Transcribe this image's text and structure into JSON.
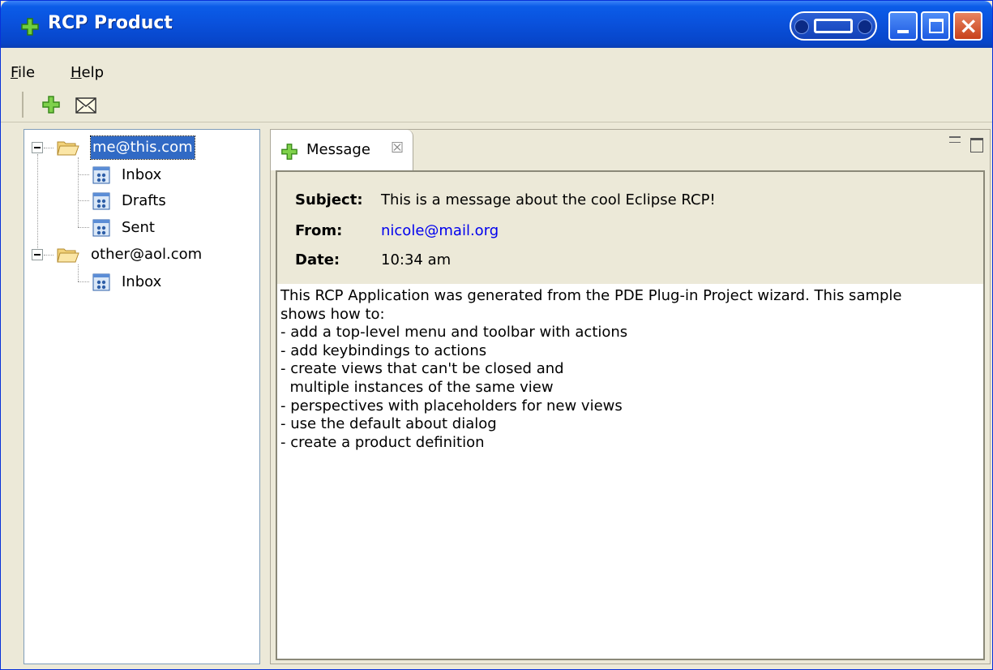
{
  "window": {
    "title": "RCP Product",
    "controls": {
      "minimize": "minimize",
      "maximize": "maximize",
      "close": "×"
    }
  },
  "menu": [
    {
      "mnemonic": "F",
      "rest": "ile"
    },
    {
      "mnemonic": "H",
      "rest": "elp"
    }
  ],
  "toolbar": {
    "icons": [
      "new-view-icon",
      "mail-icon"
    ]
  },
  "tree": {
    "accounts": [
      {
        "name": "me@this.com",
        "expanded": true,
        "selected": true,
        "folders": [
          "Inbox",
          "Drafts",
          "Sent"
        ]
      },
      {
        "name": "other@aol.com",
        "expanded": true,
        "selected": false,
        "folders": [
          "Inbox"
        ]
      }
    ]
  },
  "message_view": {
    "tab_label": "Message",
    "tab_close": "☒",
    "subject_label": "Subject:",
    "subject": "This is a message about the cool Eclipse RCP!",
    "from_label": "From:",
    "from": "nicole@mail.org",
    "date_label": "Date:",
    "date": "10:34 am",
    "body": "This RCP Application was generated from the PDE Plug-in Project wizard. This sample\nshows how to:\n- add a top-level menu and toolbar with actions\n- add keybindings to actions\n- create views that can't be closed and\n  multiple instances of the same view\n- perspectives with placeholders for new views\n- use the default about dialog\n- create a product definition"
  },
  "colors": {
    "titlebar": "#0a52dd",
    "chrome": "#ece9d8",
    "selection": "#316ac5",
    "link": "#0000ee",
    "plus_icon": "#4fae2e"
  }
}
